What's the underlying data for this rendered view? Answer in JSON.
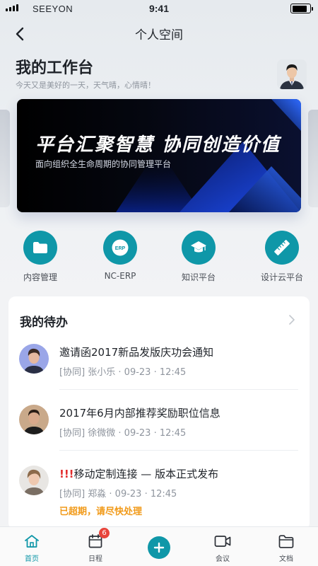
{
  "status_bar": {
    "carrier": "SEEYON",
    "time": "9:41",
    "battery_level": 0.85
  },
  "nav": {
    "title": "个人空间"
  },
  "header": {
    "title": "我的工作台",
    "subtitle": "今天又是美好的一天，天气晴，心情晴！"
  },
  "banner": {
    "slogan": "平台汇聚智慧 协同创造价值",
    "subtitle": "面向组织全生命周期的协同管理平台"
  },
  "apps": [
    {
      "label": "内容管理",
      "icon": "folder-icon"
    },
    {
      "label": "NC-ERP",
      "icon": "erp-icon",
      "icon_text": "ERP"
    },
    {
      "label": "知识平台",
      "icon": "graduation-cap-icon"
    },
    {
      "label": "设计云平台",
      "icon": "ruler-pencil-icon"
    }
  ],
  "todo": {
    "title": "我的待办",
    "items": [
      {
        "title": "邀请函2017新品发版庆功会通知",
        "meta": "[协同]  张小乐 · 09-23 · 12:45"
      },
      {
        "title": "2017年6月内部推荐奖励职位信息",
        "meta": "[协同]  徐微微 · 09-23 · 12:45"
      },
      {
        "urgent_prefix": "!!!",
        "title": "移动定制连接 — 版本正式发布",
        "meta": "[协同]  郑淼 · 09-23 · 12:45",
        "overdue": "已超期，请尽快处理"
      }
    ]
  },
  "tabbar": {
    "items": [
      {
        "label": "首页",
        "icon": "home-icon",
        "active": true
      },
      {
        "label": "日程",
        "icon": "calendar-icon",
        "badge": "6"
      },
      {
        "label": "",
        "icon": "plus-icon"
      },
      {
        "label": "会议",
        "icon": "video-camera-icon"
      },
      {
        "label": "文档",
        "icon": "folder-icon"
      }
    ]
  },
  "colors": {
    "accent": "#0f97a8",
    "badge": "#e8443a",
    "overdue": "#f19a19",
    "urgent": "#e22c2c"
  }
}
